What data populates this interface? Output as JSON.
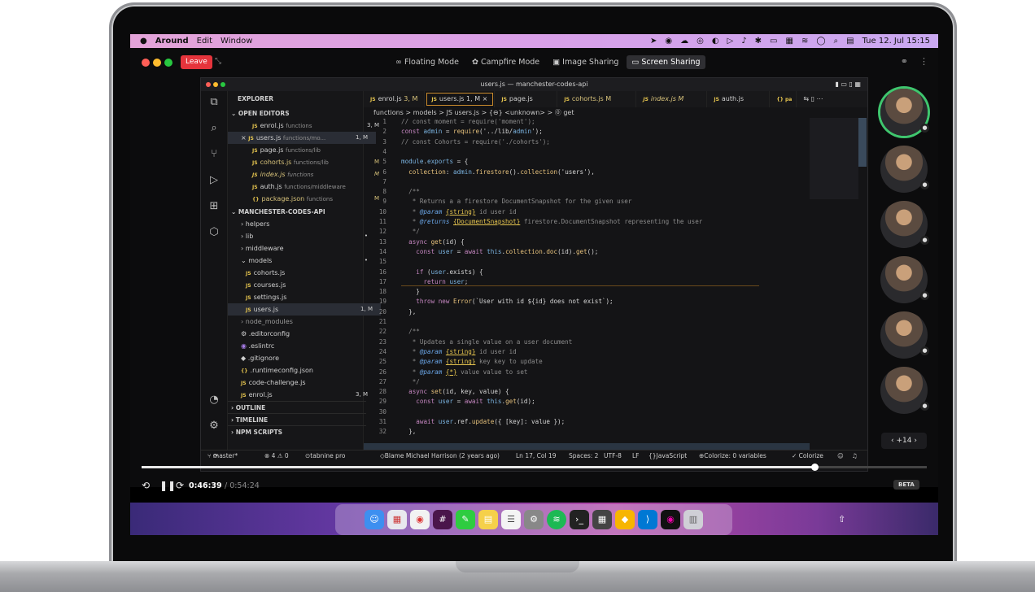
{
  "menubar": {
    "app": "Around",
    "items": [
      "Edit",
      "Window"
    ],
    "datetime": "Tue 12. Jul 15:15"
  },
  "around": {
    "leave_label": "Leave",
    "modes": [
      {
        "label": "Floating Mode",
        "icon": "floating-icon"
      },
      {
        "label": "Campfire Mode",
        "icon": "campfire-icon"
      },
      {
        "label": "Image Sharing",
        "icon": "image-icon"
      },
      {
        "label": "Screen Sharing",
        "icon": "screen-icon",
        "active": true
      }
    ],
    "more_participants": "+14"
  },
  "vscode": {
    "window_title": "users.js — manchester-codes-api",
    "explorer_title": "EXPLORER",
    "open_editors_title": "OPEN EDITORS",
    "open_editors": [
      {
        "name": "enrol.js",
        "path": "functions",
        "badge": "3, M"
      },
      {
        "name": "users.js",
        "path": "functions/mo...",
        "badge": "1, M",
        "close": "×"
      },
      {
        "name": "page.js",
        "path": "functions/lib",
        "badge": ""
      },
      {
        "name": "cohorts.js",
        "path": "functions/lib",
        "badge": "M"
      },
      {
        "name": "index.js",
        "path": "functions",
        "badge": "M"
      },
      {
        "name": "auth.js",
        "path": "functions/middleware",
        "badge": ""
      },
      {
        "name": "package.json",
        "path": "functions",
        "badge": "M"
      }
    ],
    "project_title": "MANCHESTER-CODES-API",
    "tree": [
      {
        "label": "helpers",
        "type": "folder"
      },
      {
        "label": "lib",
        "type": "folder"
      },
      {
        "label": "middleware",
        "type": "folder"
      },
      {
        "label": "models",
        "type": "folder-open"
      },
      {
        "label": "cohorts.js",
        "type": "js"
      },
      {
        "label": "courses.js",
        "type": "js"
      },
      {
        "label": "settings.js",
        "type": "js"
      },
      {
        "label": "users.js",
        "type": "js",
        "badge": "1, M"
      },
      {
        "label": "node_modules",
        "type": "folder"
      },
      {
        "label": ".editorconfig",
        "type": "file"
      },
      {
        "label": ".eslintrc",
        "type": "file"
      },
      {
        "label": ".gitignore",
        "type": "file"
      },
      {
        "label": ".runtimeconfig.json",
        "type": "json"
      },
      {
        "label": "code-challenge.js",
        "type": "js"
      },
      {
        "label": "enrol.js",
        "type": "js",
        "badge": "3, M"
      }
    ],
    "outline_title": "OUTLINE",
    "timeline_title": "TIMELINE",
    "npm_title": "NPM SCRIPTS",
    "tabs": [
      {
        "label": "enrol.js",
        "meta": "3, M"
      },
      {
        "label": "users.js",
        "meta": "1, M",
        "close": "×",
        "active": true
      },
      {
        "label": "page.js",
        "meta": ""
      },
      {
        "label": "cohorts.js",
        "meta": "M"
      },
      {
        "label": "index.js",
        "meta": "M"
      },
      {
        "label": "auth.js",
        "meta": ""
      },
      {
        "label": "{} pa",
        "meta": ""
      }
    ],
    "breadcrumb": "functions > models > JS users.js > {⊖} <unknown> > ⓪ get",
    "code_lines": [
      "// const moment = require('moment');",
      "const admin = require('../lib/admin');",
      "// const Cohorts = require('./cohorts');",
      "",
      "module.exports = {",
      "  collection: admin.firestore().collection('users'),",
      "",
      "  /**",
      "   * Returns a a firestore DocumentSnapshot for the given user",
      "   * @param {string} id user id",
      "   * @returns {DocumentSnapshot} firestore.DocumentSnapshot representing the user",
      "   */",
      "  async get(id) {",
      "    const user = await this.collection.doc(id).get();",
      "",
      "    if (user.exists) {",
      "      return user;",
      "    }",
      "    throw new Error(`User with id ${id} does not exist`);",
      "  },",
      "",
      "  /**",
      "   * Updates a single value on a user document",
      "   * @param {string} id user id",
      "   * @param {string} key key to update",
      "   * @param {*} value value to set",
      "   */",
      "  async set(id, key, value) {",
      "    const user = await this.get(id);",
      "",
      "    await user.ref.update({ [key]: value });",
      "  },"
    ],
    "status": {
      "branch": "master*",
      "problems": "⊗ 4 ⚠ 0",
      "tabnine": "tabnine pro",
      "blame": "Blame Michael Harrison (2 years ago)",
      "position": "Ln 17, Col 19",
      "spaces": "Spaces: 2",
      "encoding": "UTF-8",
      "eol": "LF",
      "language": "JavaScript",
      "colorize": "Colorize: 0 variables",
      "colorize_btn": "✓ Colorize"
    }
  },
  "player": {
    "current_time": "0:46:39",
    "total_time": "/ 0:54:24",
    "progress": 0.857,
    "beta_label": "BETA"
  },
  "colors": {
    "leave": "#e5343c",
    "active_speaker": "#3fc66e",
    "keyword": "#c586c0",
    "function": "#e5c07b"
  }
}
